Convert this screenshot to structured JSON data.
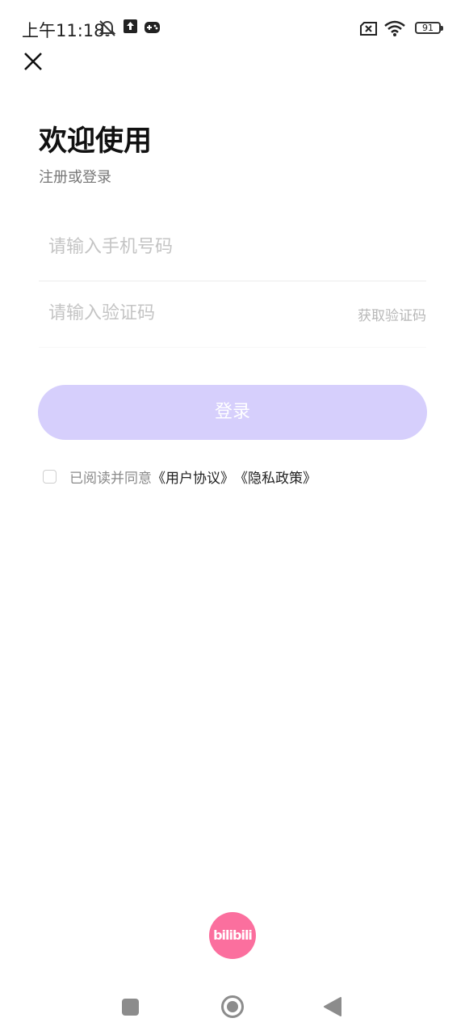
{
  "status_bar": {
    "time": "上午11:18",
    "battery": "91",
    "icons": [
      "mute-bell-icon",
      "upload-icon",
      "gamepad-icon",
      "no-sim-icon",
      "wifi-icon",
      "battery-icon"
    ]
  },
  "header": {
    "close_icon": "close-icon"
  },
  "main": {
    "title": "欢迎使用",
    "subtitle": "注册或登录",
    "phone_placeholder": "请输入手机号码",
    "code_placeholder": "请输入验证码",
    "get_code_label": "获取验证码",
    "login_label": "登录",
    "agreement": {
      "prefix": "已阅读并同意",
      "user_agreement": "《用户协议》",
      "privacy_policy": "《隐私政策》"
    }
  },
  "footer": {
    "logo_text": "bilibili"
  },
  "colors": {
    "login_button": "#d6cffc",
    "logo": "#fb6f9e",
    "placeholder": "#c4c4c4"
  },
  "nav_bar": {
    "icons": [
      "recent-apps-icon",
      "home-icon",
      "back-icon"
    ]
  }
}
